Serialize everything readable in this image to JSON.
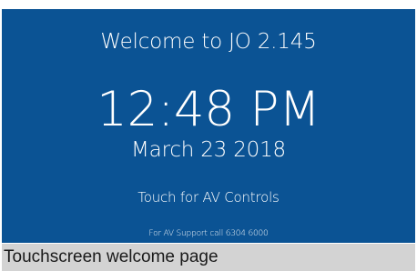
{
  "screen": {
    "welcome": "Welcome to JO 2.145",
    "time": "12:48 PM",
    "date": "March 23 2018",
    "touch_prompt": "Touch for AV Controls",
    "support_text": "For AV Support call 6304 6000",
    "background_color": "#0b5394",
    "text_color": "#ffffff"
  },
  "caption": {
    "text": "Touchscreen welcome page",
    "background_color": "#d3d3d3"
  }
}
